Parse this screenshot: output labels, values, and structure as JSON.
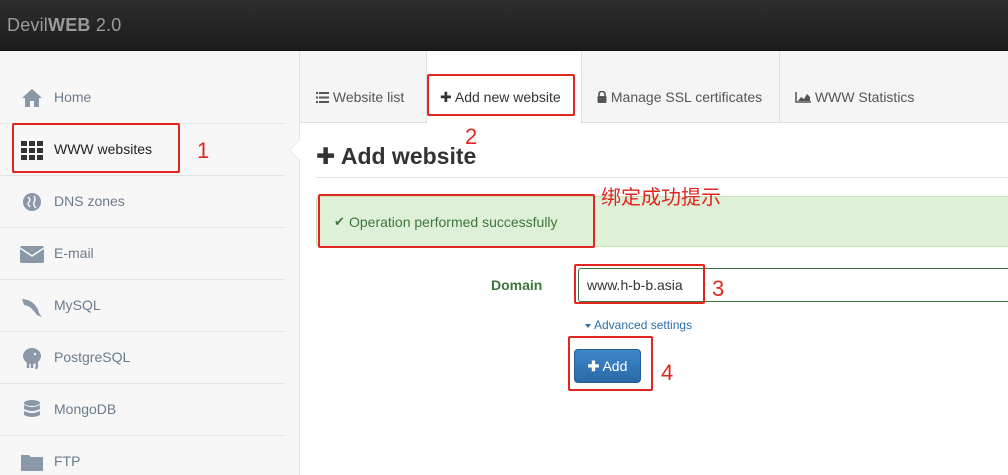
{
  "app": {
    "brand_main": "Devil",
    "brand_bold": "WEB",
    "brand_version": " 2.0"
  },
  "sidebar": {
    "items": [
      {
        "label": "Home",
        "icon": "home-icon"
      },
      {
        "label": "WWW websites",
        "icon": "grid-icon",
        "active": true
      },
      {
        "label": "DNS zones",
        "icon": "globe-icon"
      },
      {
        "label": "E-mail",
        "icon": "envelope-icon"
      },
      {
        "label": "MySQL",
        "icon": "dolphin-icon"
      },
      {
        "label": "PostgreSQL",
        "icon": "elephant-icon"
      },
      {
        "label": "MongoDB",
        "icon": "database-icon"
      },
      {
        "label": "FTP",
        "icon": "folder-icon"
      }
    ]
  },
  "tabs": [
    {
      "label": "Website list",
      "icon": "list-icon"
    },
    {
      "label": "Add new website",
      "icon": "plus-icon",
      "active": true
    },
    {
      "label": "Manage SSL certificates",
      "icon": "lock-icon"
    },
    {
      "label": "WWW Statistics",
      "icon": "chart-icon"
    }
  ],
  "main": {
    "title": "Add website",
    "alert": "Operation performed successfully",
    "domain_label": "Domain",
    "domain_value": "www.h-b-b.asia",
    "advanced": "Advanced settings",
    "add_button": "Add"
  },
  "annotations": {
    "n1": "1",
    "n2": "2",
    "n3": "3",
    "n4": "4",
    "success_note": "绑定成功提示"
  },
  "colors": {
    "accent": "#2b6aa8",
    "success_bg": "#dff0d8",
    "success_text": "#3c763d",
    "annotation": "#e0261f"
  }
}
